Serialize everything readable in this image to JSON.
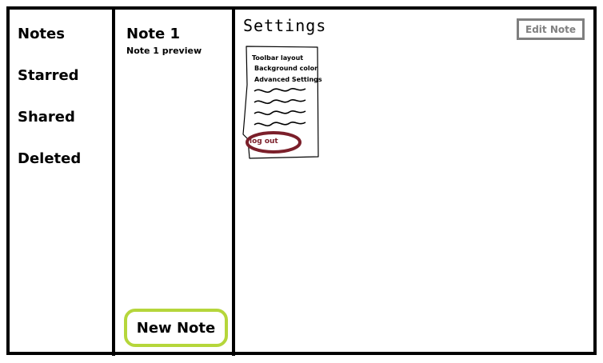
{
  "nav": {
    "items": [
      "Notes",
      "Starred",
      "Shared",
      "Deleted"
    ]
  },
  "notes_list": {
    "note": {
      "title": "Note 1",
      "preview": "Note 1 preview"
    },
    "new_note_label": "New Note"
  },
  "main": {
    "edit_note_label": "Edit Note",
    "settings_label": "Settings",
    "settings_menu": {
      "items": [
        "Toolbar layout",
        "Background color",
        "Advanced Settings"
      ],
      "logout_label": "log out"
    }
  },
  "colors": {
    "new_note_border": "#b5d63b",
    "edit_note_border": "#7f7f7f",
    "logout_highlight": "#7b1f2a"
  }
}
